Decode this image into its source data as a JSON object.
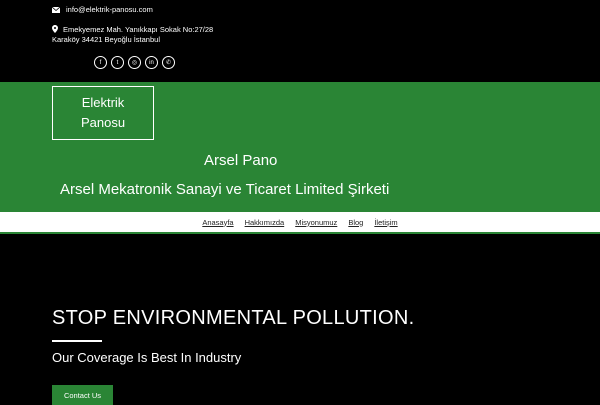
{
  "topbar": {
    "email": "info@elektrik-panosu.com",
    "address_line1": "Emekyemez Mah. Yanıkkapı Sokak No:27/28",
    "address_line2": "Karaköy 34421 Beyoğlu İstanbul",
    "socials": [
      "facebook-icon",
      "twitter-icon",
      "instagram-icon",
      "linkedin-icon",
      "whatsapp-icon"
    ]
  },
  "header": {
    "logo_line1": "Elektrik",
    "logo_line2": "Panosu",
    "site_title": "Arsel Pano",
    "site_description": "Arsel Mekatronik Sanayi ve Ticaret Limited Şirketi"
  },
  "nav": {
    "items": [
      "Anasayfa",
      "Hakkımızda",
      "Misyonumuz",
      "Blog",
      "İletişim"
    ]
  },
  "hero": {
    "title": "STOP ENVIRONMENTAL POLLUTION.",
    "subtitle": "Our Coverage Is Best In Industry",
    "cta_label": "Contact Us"
  },
  "colors": {
    "brand_green": "#2a8535",
    "background": "#000000"
  }
}
